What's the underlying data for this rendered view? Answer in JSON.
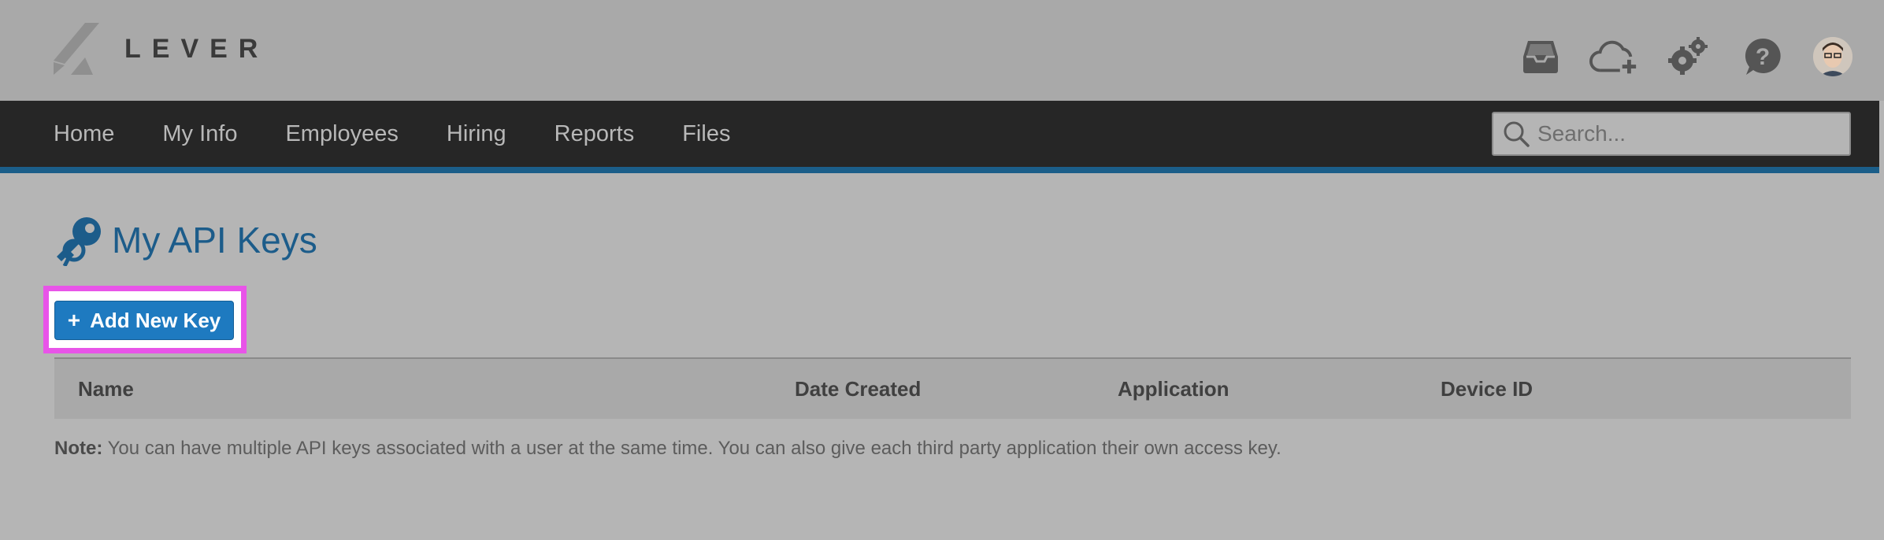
{
  "brand": {
    "name": "LEVER"
  },
  "header": {
    "icons": [
      "inbox-icon",
      "cloud-upload-icon",
      "gears-icon",
      "help-icon"
    ]
  },
  "nav": {
    "items": [
      "Home",
      "My Info",
      "Employees",
      "Hiring",
      "Reports",
      "Files"
    ],
    "search_placeholder": "Search..."
  },
  "page": {
    "title": "My API Keys",
    "add_button_label": "Add New Key",
    "add_button_icon": "plus-icon",
    "table_headers": [
      "Name",
      "Date Created",
      "Application",
      "Device ID"
    ],
    "note_label": "Note:",
    "note_text": "You can have multiple API keys associated with a user at the same time. You can also give each third party application their own access key."
  },
  "colors": {
    "title_blue": "#1c5c8a",
    "button_blue": "#1e7ac0",
    "nav_bg": "#262626",
    "nav_accent": "#1b5e89",
    "highlight": "#e854e8"
  }
}
